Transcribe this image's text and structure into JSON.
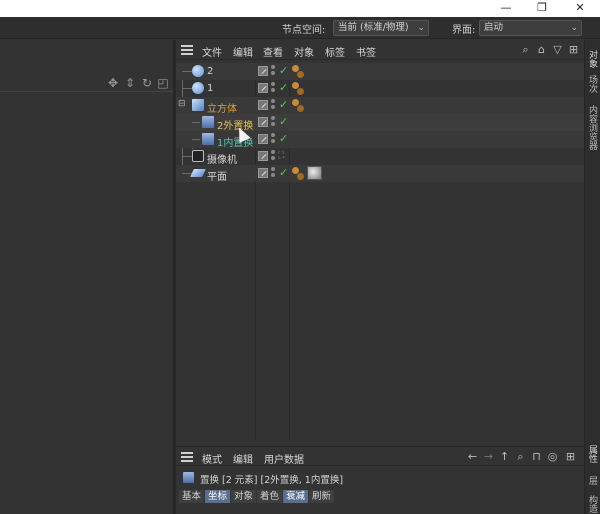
{
  "window": {
    "minimize": "—",
    "restore": "❐",
    "close": "✕"
  },
  "topbar": {
    "node_space_label": "节点空间:",
    "node_space_value": "当前 (标准/物理)",
    "interface_label": "界面:",
    "interface_value": "启动"
  },
  "object_manager": {
    "menu": [
      "文件",
      "编辑",
      "查看",
      "对象",
      "标签",
      "书签"
    ],
    "rows": [
      {
        "label": "2",
        "color": "#d4d4d4",
        "icon_color": "#8ab4e8"
      },
      {
        "label": "1",
        "color": "#d4d4d4",
        "icon_color": "#8ab4e8"
      },
      {
        "label": "立方体",
        "color": "#e0a040",
        "icon_color": "#8ab4e8"
      },
      {
        "label": "2外置换",
        "color": "#e0c060",
        "icon_color": "#6f8fc0"
      },
      {
        "label": "1内置换",
        "color": "#4ec9b0",
        "icon_color": "#6f8fc0"
      },
      {
        "label": "摄像机",
        "color": "#d4d4d4",
        "icon_color": "#cccccc"
      },
      {
        "label": "平面",
        "color": "#d4d4d4",
        "icon_color": "#8ab4e8"
      }
    ]
  },
  "right_tabs": {
    "objects": "对象",
    "layers": "场次",
    "content_browser": "内容浏览器",
    "attributes": "属性",
    "layer": "层",
    "structure": "构造"
  },
  "attributes": {
    "menu": [
      "模式",
      "编辑",
      "用户数据"
    ],
    "info": "置换 [2 元素] [2外置换, 1内置换]",
    "tabs": [
      {
        "label": "基本",
        "selected": false
      },
      {
        "label": "坐标",
        "selected": true
      },
      {
        "label": "对象",
        "selected": false
      },
      {
        "label": "着色",
        "selected": false
      },
      {
        "label": "衰减",
        "selected": true
      },
      {
        "label": "刷新",
        "selected": false
      }
    ]
  },
  "colors": {
    "accent_orange": "#e0a040",
    "accent_teal": "#4ec9b0",
    "check_green": "#62c262",
    "selected_tab": "#5a6f8e"
  }
}
